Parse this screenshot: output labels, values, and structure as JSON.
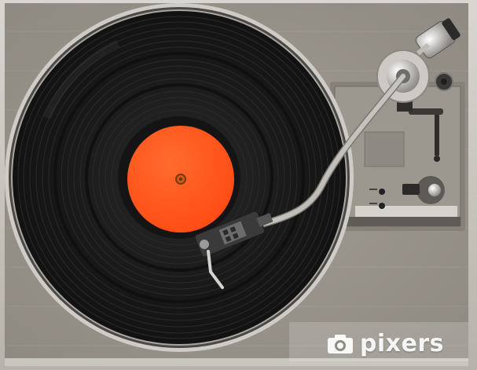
{
  "image": {
    "subject": "turntable",
    "colors": {
      "canvas_face": "#8f8a82",
      "plinth": "#9a958d",
      "platter_ring": "#c9c6c2",
      "record": "#161616",
      "label": "#ff5a1e",
      "tonearm": "#d8d6d2"
    }
  },
  "watermark": {
    "text": "pixers",
    "icon": "camera-icon"
  }
}
